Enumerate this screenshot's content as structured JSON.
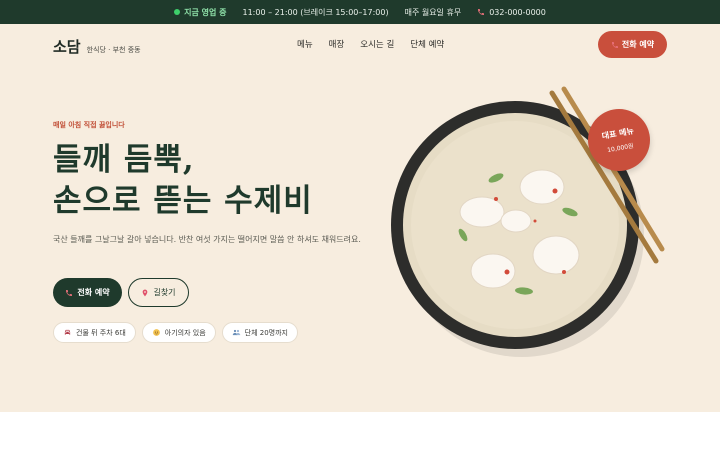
{
  "topbar": {
    "status": "지금 영업 중",
    "hours": "11:00 – 21:00 (브레이크 15:00–17:00)",
    "closed": "매주 월요일 휴무",
    "phone": "032-000-0000"
  },
  "header": {
    "brand": "소담",
    "subtitle": "한식당 · 부천 중동",
    "nav": [
      "메뉴",
      "매장",
      "오시는 길",
      "단체 예약"
    ],
    "cta": "전화 예약"
  },
  "hero": {
    "eyebrow": "매일 아침 직접 끓입니다",
    "headline_line1": "들깨 듬뿍,",
    "headline_line2": "손으로 뜯는 수제비",
    "description": "국산 들깨를 그날그날 갈아 넣습니다. 반찬 여섯 가지는 떨어지면 말씀 안 하셔도 채워드려요.",
    "primary_button": "전화 예약",
    "secondary_button": "길찾기",
    "chips": [
      {
        "label": "건물 뒤 주차 6대",
        "icon": "car-icon"
      },
      {
        "label": "아기의자 있음",
        "icon": "baby-icon"
      },
      {
        "label": "단체 20명까지",
        "icon": "group-icon"
      }
    ]
  },
  "badge": {
    "title": "대표 메뉴",
    "price": "10,000원"
  },
  "colors": {
    "dark_green": "#1f3a2c",
    "accent_red": "#c94f3c",
    "cream": "#f7eddf"
  }
}
